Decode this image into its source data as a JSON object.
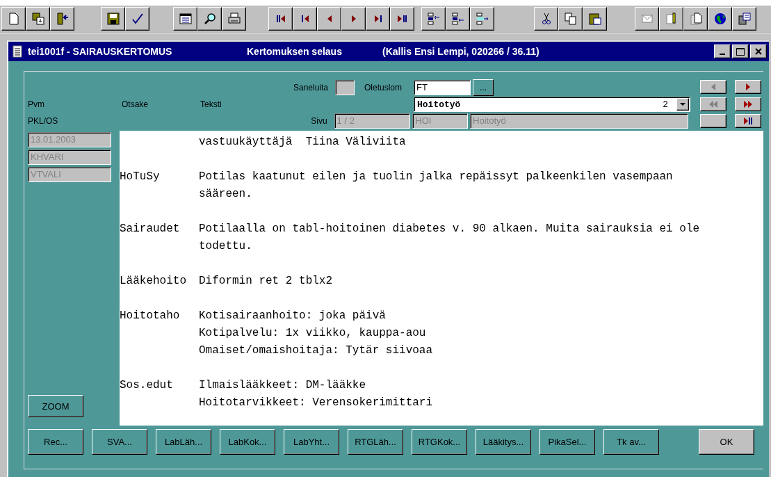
{
  "window": {
    "title": "tei1001f - SAIRAUSKERTOMUS",
    "subtitle": "Kertomuksen selaus",
    "patient": "(Kallis Ensi Lempi, 020266 / 36.11)"
  },
  "header": {
    "saneluita": {
      "label": "Saneluita",
      "checked": false
    },
    "oletuslom": {
      "label": "Oletuslom",
      "value": "FT",
      "button": "..."
    },
    "columns": [
      "Pvm",
      "Otsake",
      "Teksti"
    ],
    "combo": {
      "value": "Hoitotyö",
      "number": "2"
    },
    "pkl_label": "PKL/OS",
    "sivu": {
      "label": "Sivu",
      "value": "1 / 2"
    },
    "code": "HOI",
    "code_name": "Hoitotyö"
  },
  "nav_buttons": [
    {
      "kind": "prev",
      "disabled": true
    },
    {
      "kind": "next",
      "disabled": false
    },
    {
      "kind": "rewind",
      "disabled": true
    },
    {
      "kind": "fast_forward",
      "disabled": false
    },
    {
      "kind": "blank"
    },
    {
      "kind": "last",
      "disabled": false
    }
  ],
  "record_fields": [
    "13.01.2003",
    "KHVARI",
    "VTVALI"
  ],
  "entries": [
    {
      "lines": [
        "vastuukäyttäjä  Tiina Väliviita"
      ]
    },
    {
      "heading": "HoTuSy",
      "lines": [
        "Potilas kaatunut eilen ja tuolin jalka repäissyt palkeenkilen vasempaan",
        "sääreen."
      ]
    },
    {
      "heading": "Sairaudet",
      "lines": [
        "Potilaalla on tabl-hoitoinen diabetes v. 90 alkaen. Muita sairauksia ei ole",
        "todettu."
      ]
    },
    {
      "heading": "Lääkehoito",
      "lines": [
        "Diformin ret 2 tblx2"
      ]
    },
    {
      "heading": "Hoitotaho",
      "lines": [
        "Kotisairaanhoito: joka päivä",
        "Kotipalvelu: 1x viikko, kauppa-aou",
        "Omaiset/omaishoitaja: Tytär siivoaa"
      ]
    },
    {
      "heading": "Sos.edut",
      "lines": [
        "Ilmaislääkkeet: DM-lääkke",
        "Hoitotarvikkeet: Verensokerimittari"
      ]
    }
  ],
  "zoom_button": "ZOOM",
  "buttons": [
    "Rec...",
    "SVA...",
    "LabLäh...",
    "LabKok...",
    "LabYht...",
    "RTGLäh...",
    "RTGKok...",
    "Lääkitys...",
    "PikaSel...",
    "Tk av..."
  ],
  "ok_button": "OK"
}
